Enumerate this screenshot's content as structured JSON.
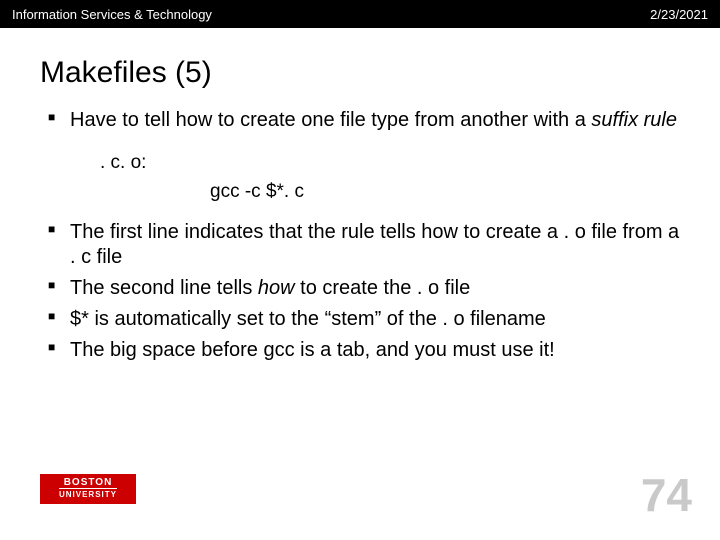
{
  "header": {
    "org": "Information Services & Technology",
    "date": "2/23/2021"
  },
  "title": "Makefiles (5)",
  "bullets": {
    "b1_pre": "Have to tell how to create one file type from another with a ",
    "b1_em": "suffix rule",
    "code1": ". c. o:",
    "code2": "gcc  -c  $*. c",
    "b2": "The first line indicates that the rule tells how to create a . o file from a . c file",
    "b3_pre": "The second line tells ",
    "b3_em": "how",
    "b3_post": " to create the . o file",
    "b4": "$* is automatically set to the “stem” of the . o filename",
    "b5": "The big space before gcc is a tab, and you must use it!"
  },
  "logo": {
    "l1": "BOSTON",
    "l2": "UNIVERSITY"
  },
  "page_number": "74"
}
